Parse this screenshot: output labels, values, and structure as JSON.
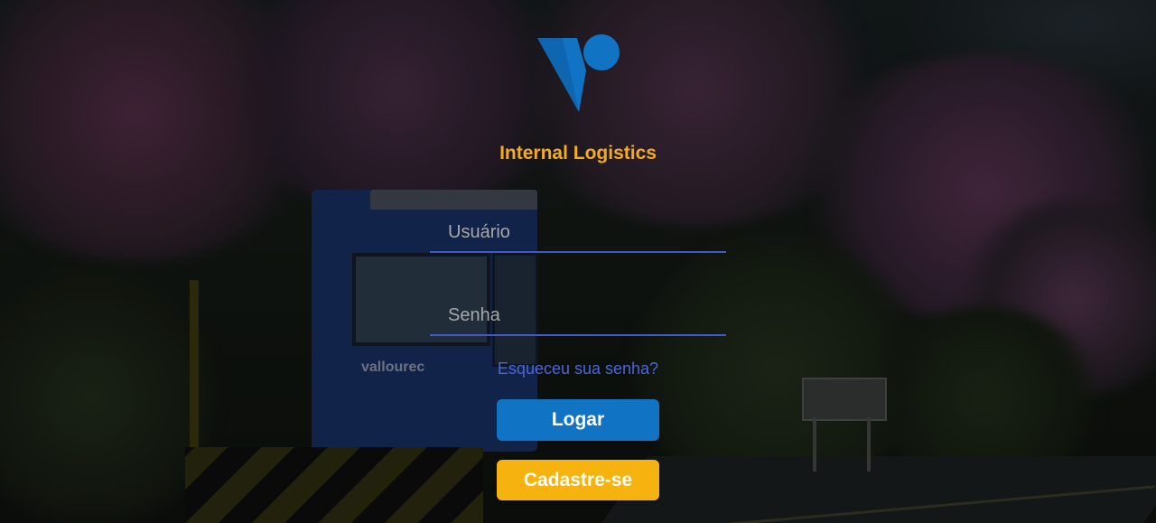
{
  "app": {
    "title": "Internal Logistics"
  },
  "login_form": {
    "username_placeholder": "Usuário",
    "password_placeholder": "Senha",
    "forgot_password_label": "Esqueceu sua senha?",
    "login_button_label": "Logar",
    "register_button_label": "Cadastre-se"
  },
  "background": {
    "truck_brand": "vallourec"
  },
  "colors": {
    "title": "#f5ab1b",
    "logo": "#1173c4",
    "input_underline": "#3e5ac8",
    "link": "#4a67d6",
    "login_button": "#1173c4",
    "register_button": "#f6b30f"
  },
  "icons": {
    "logo": "vallourec-logo"
  }
}
